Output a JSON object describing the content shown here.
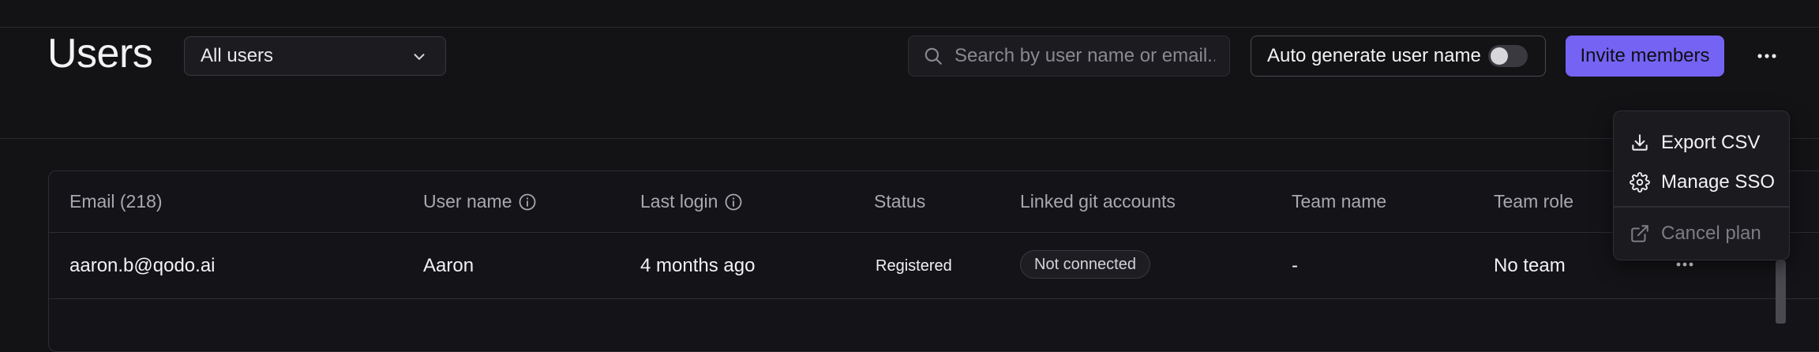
{
  "header": {
    "title": "Users",
    "filter": {
      "selected": "All users"
    },
    "search": {
      "placeholder": "Search by user name or email...",
      "value": ""
    },
    "auto_generate": {
      "label": "Auto generate user name",
      "enabled": false
    },
    "invite_label": "Invite members"
  },
  "menu": {
    "items": [
      {
        "label": "Export CSV",
        "icon": "download-icon",
        "disabled": false
      },
      {
        "label": "Manage SSO",
        "icon": "gear-icon",
        "disabled": false
      },
      {
        "label": "Cancel plan",
        "icon": "external-link-icon",
        "disabled": true
      }
    ]
  },
  "table": {
    "columns": [
      {
        "label": "Email (218)",
        "info": false
      },
      {
        "label": "User name",
        "info": true
      },
      {
        "label": "Last login",
        "info": true
      },
      {
        "label": "Status",
        "info": false
      },
      {
        "label": "Linked git accounts",
        "info": false
      },
      {
        "label": "Team name",
        "info": false
      },
      {
        "label": "Team role",
        "info": false
      }
    ],
    "rows": [
      {
        "email": "aaron.b@qodo.ai",
        "user_name": "Aaron",
        "last_login": "4 months ago",
        "status": "Registered",
        "git_accounts": "Not connected",
        "team_name": "-",
        "team_role": "No team"
      }
    ]
  },
  "colors": {
    "background": "#131215",
    "accent": "#7563f4",
    "border": "#2d2c31"
  }
}
